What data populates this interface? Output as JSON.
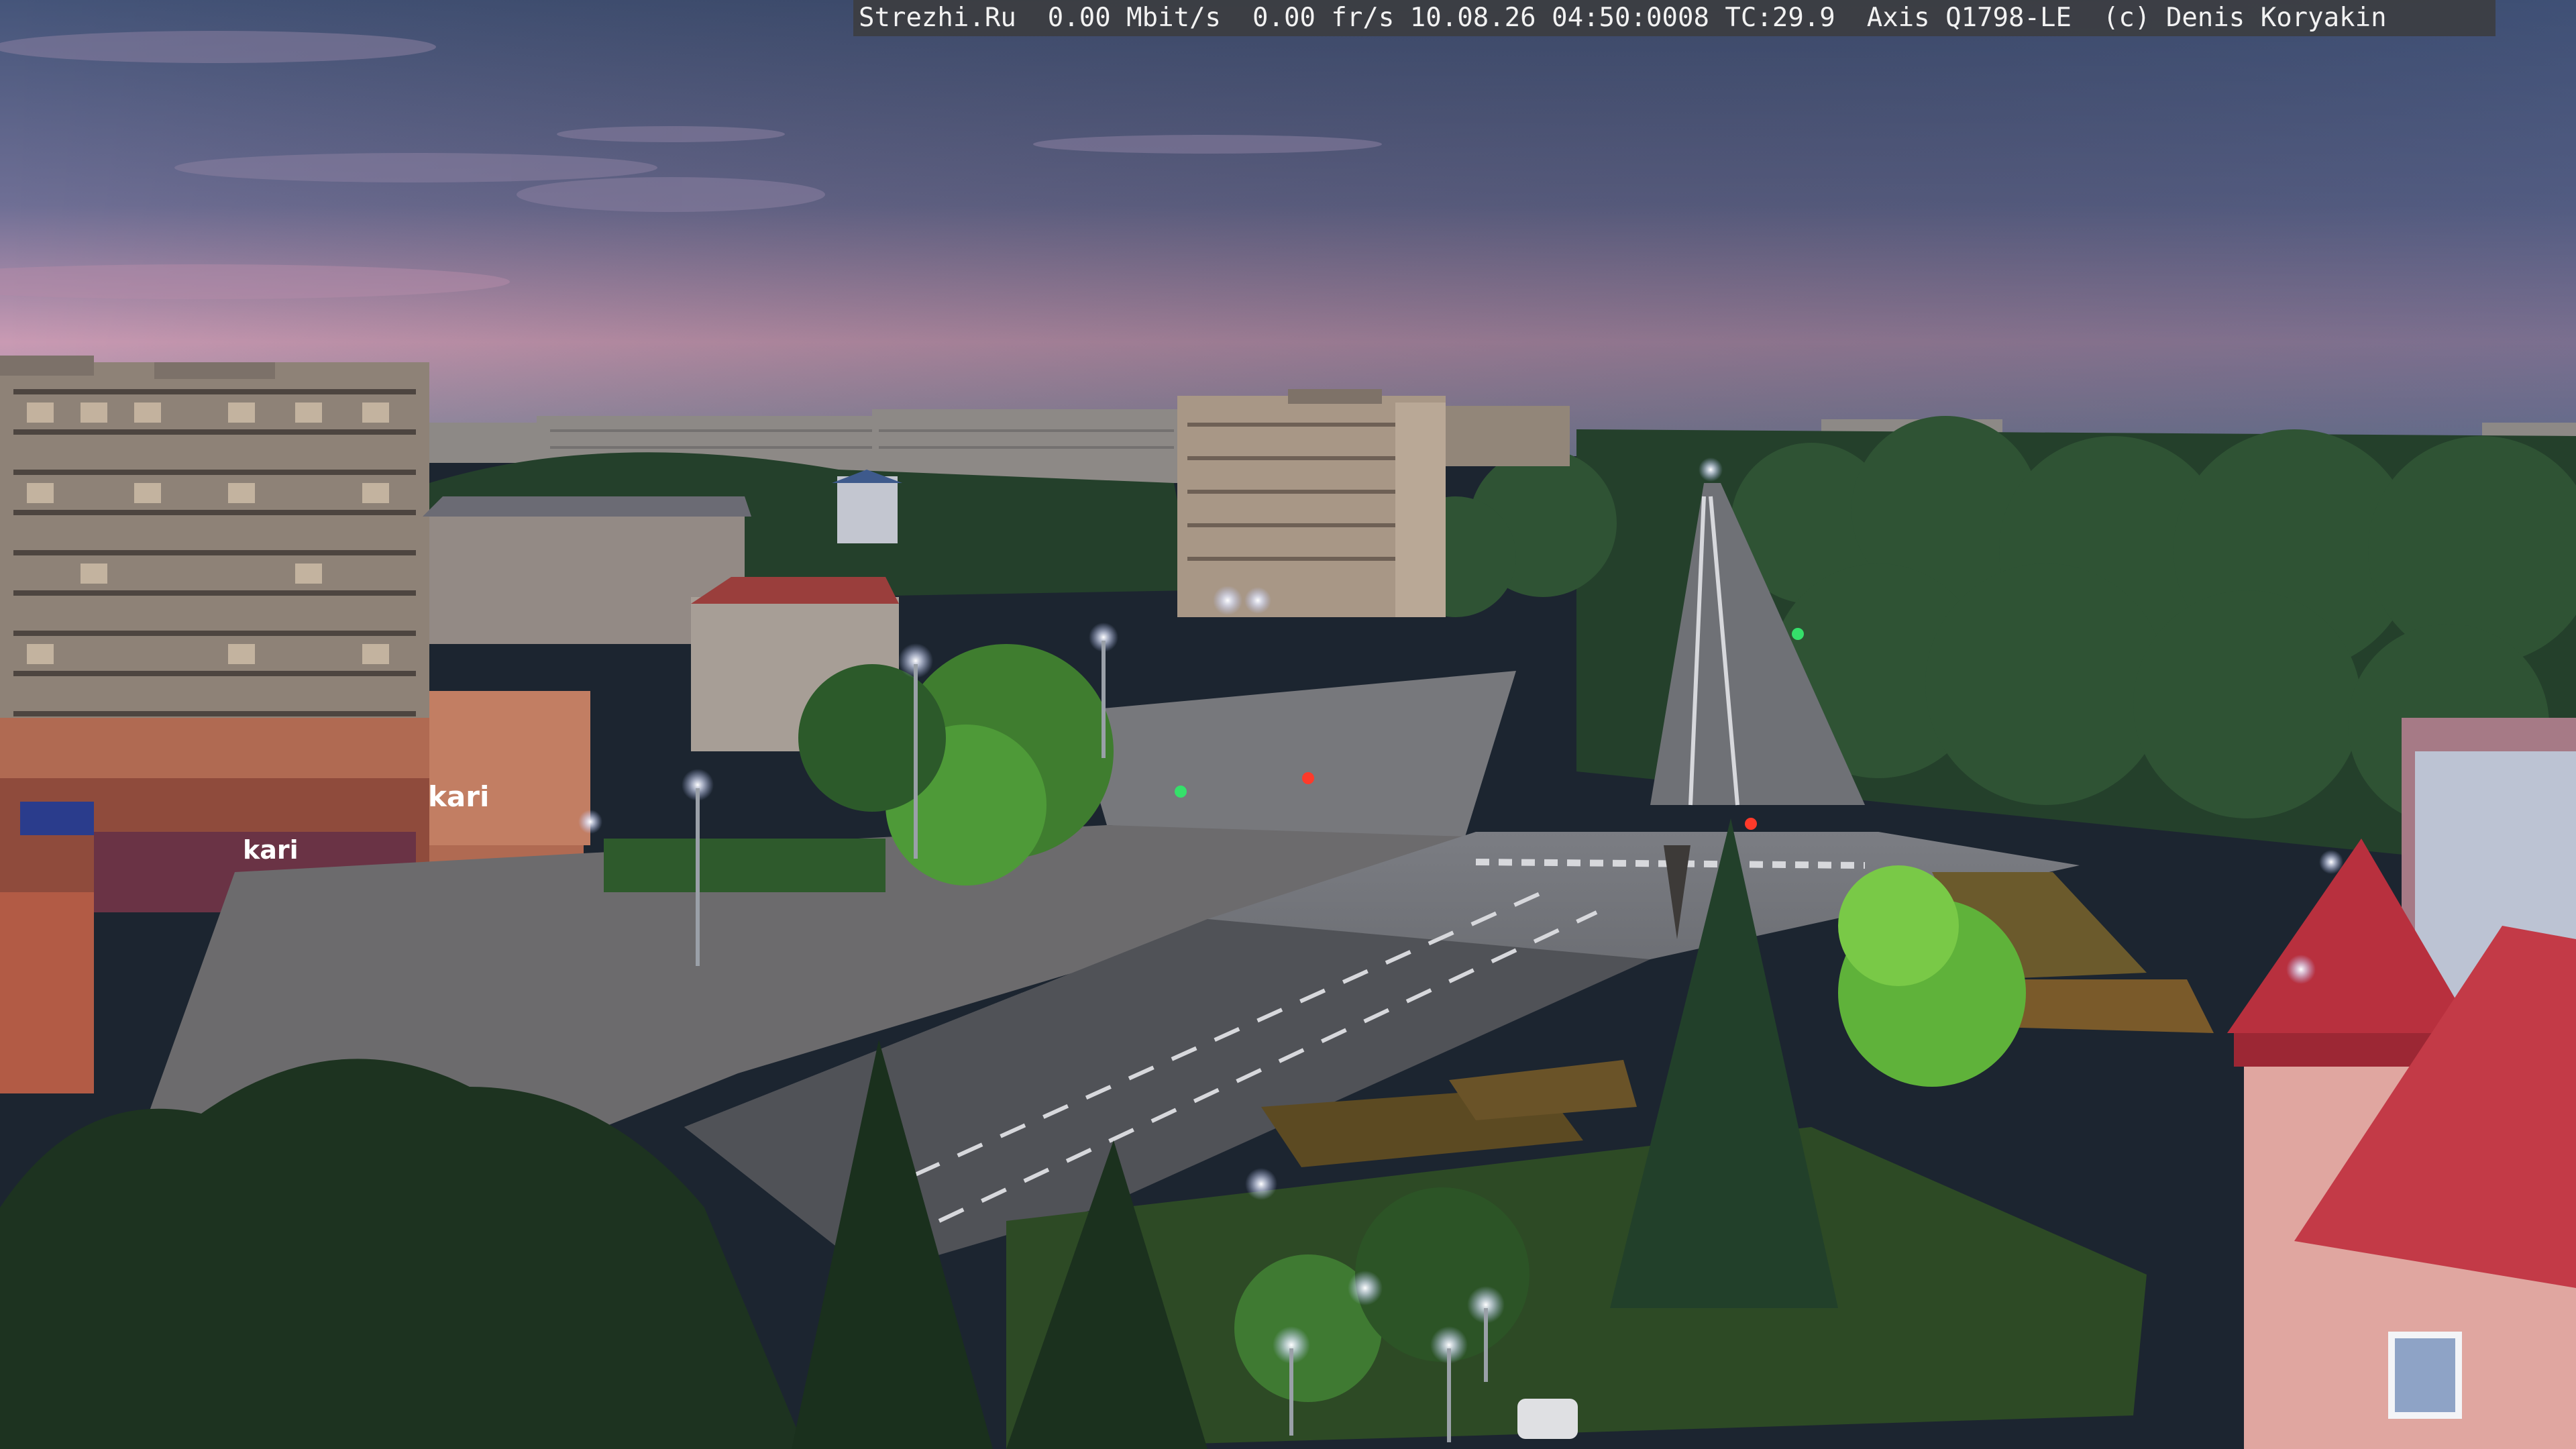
{
  "overlay": {
    "text": "Strezhi.Ru  0.00 Mbit/s  0.00 fr/s 10.08.26 04:50:0008 TC:29.9  Axis Q1798-LE  (c) Denis Koryakin"
  },
  "signs": {
    "store_left": "kari",
    "store_lower": "kari"
  },
  "colors": {
    "sky_top": "#4a5a7e",
    "sky_horizon": "#d8a3b8",
    "road": "#55585c",
    "trees": "#1f3a24",
    "streetlight": "#f4f7ff",
    "roof_red": "#b83a44"
  }
}
